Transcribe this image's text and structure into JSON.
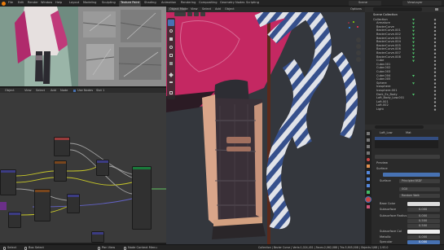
{
  "topbar": {
    "menus": [
      "File",
      "Edit",
      "Render",
      "Window",
      "Help"
    ],
    "workspaces": [
      "Layout",
      "Modeling",
      "Sculpting",
      "UV Editing",
      "Texture Paint",
      "Shading",
      "Animation",
      "Rendering",
      "Compositing",
      "Geometry Nodes",
      "Scripting"
    ],
    "active_workspace": "Texture Paint",
    "scene_label": "Scene",
    "view_layer_label": "ViewLayer"
  },
  "image_editor": {
    "header_items": [
      "View",
      "Image",
      "Image",
      "View"
    ]
  },
  "node_editor": {
    "header_items": [
      "Object",
      "View",
      "Select",
      "Add",
      "Node",
      "Use Nodes",
      "Slot 1"
    ]
  },
  "viewport": {
    "mode_label": "Object Mode",
    "menus": [
      "View",
      "Select",
      "Add",
      "Object"
    ],
    "options_label": "Options"
  },
  "outliner": {
    "title": "Scene Collection",
    "search_placeholder": "",
    "items": [
      "Collection",
      "Armature",
      "BezierCurve",
      "BezierCurve.001",
      "BezierCurve.002",
      "BezierCurve.003",
      "BezierCurve.004",
      "BezierCurve.005",
      "BezierCurve.006",
      "BezierCurve.007",
      "BezierCurve.008",
      "Cube",
      "Cube.001",
      "Cube.002",
      "Cube.003",
      "Cube.004",
      "Cube.005",
      "Sphere",
      "Icosphere",
      "Icosphere.001",
      "Dark_Ex_Body",
      "Loft_Body_Low.001",
      "Loft.001",
      "Loft.002",
      "Light"
    ]
  },
  "properties": {
    "object_label": "Loft_Low",
    "material_slot": "Mat",
    "surface_label": "Surface",
    "preview_label": "Preview",
    "surface_shader": "Principled BSDF",
    "base_color_label": "Base Color",
    "subsurface_label": "Subsurface",
    "subsurface_radius_label": "Subsurface Radius",
    "subsurface_color_label": "Subsurface Col",
    "metallic_label": "Metallic",
    "specular_label": "Specular",
    "values": [
      "0.000",
      "0.000",
      "0.500",
      "0.500",
      "0.000",
      "0.000"
    ],
    "random_walk": "Random Walk",
    "ggx": "GGX"
  },
  "statusbar": {
    "left": [
      "Select",
      "Box Select",
      "Pan View",
      "Node Context Menu"
    ],
    "right": "Collection | Bezier Curve | Verts:1,024,451 | Faces:2,062,088 | Tris:3,905,008 | Objects:1/68 | 2.93.0"
  },
  "colors": {
    "accent": "#4772b3",
    "cloth": "#c62560",
    "boot": "#3a3038"
  }
}
